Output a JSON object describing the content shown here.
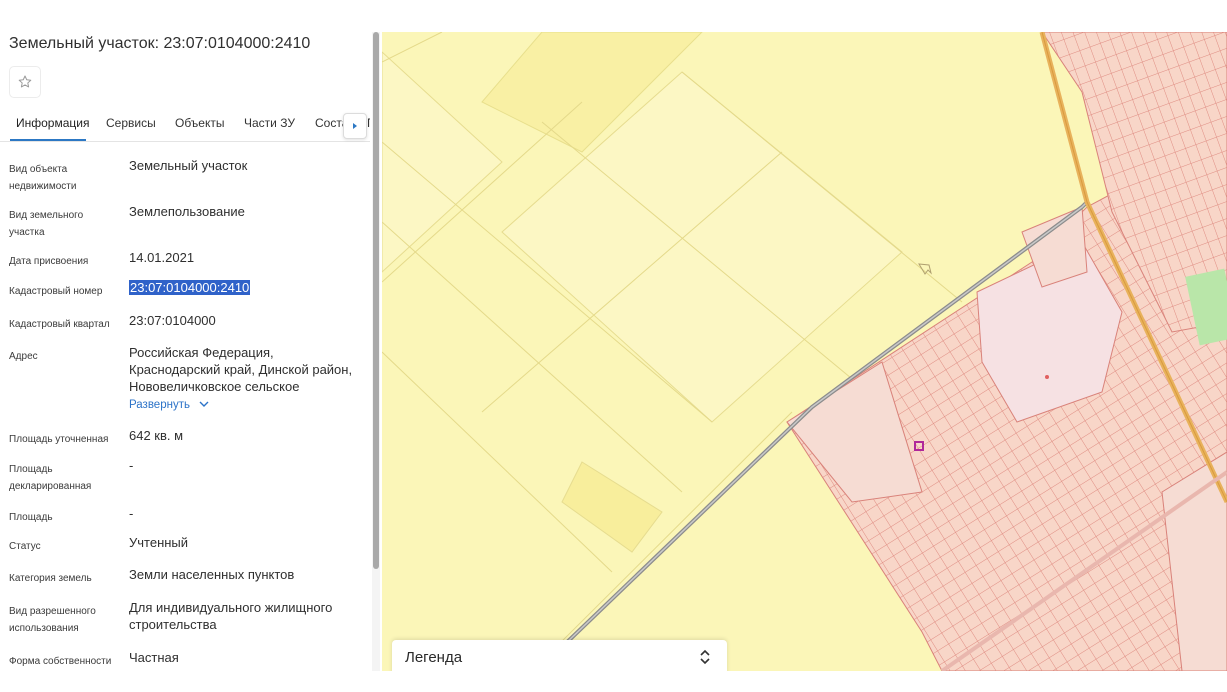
{
  "header": {
    "title": "Земельный участок: 23:07:0104000:2410"
  },
  "tabs": [
    {
      "label": "Информация",
      "active": true
    },
    {
      "label": "Сервисы"
    },
    {
      "label": "Объекты"
    },
    {
      "label": "Части ЗУ"
    },
    {
      "label": "Соста"
    },
    {
      "label": "П"
    }
  ],
  "fields": [
    {
      "label": "Вид объекта недвижимости",
      "value": "Земельный участок"
    },
    {
      "label": "Вид земельного участка",
      "value": "Землепользование"
    },
    {
      "label": "Дата присвоения",
      "value": "14.01.2021"
    },
    {
      "label": "Кадастровый номер",
      "value": "23:07:0104000:2410"
    },
    {
      "label": "Кадастровый квартал",
      "value": "23:07:0104000"
    },
    {
      "label": "Адрес",
      "value": "Российская Федерация, Краснодарский край, Динской район, Нововеличковское сельское",
      "link": "Развернуть"
    },
    {
      "label": "Площадь уточненная",
      "value": "642 кв. м"
    },
    {
      "label": "Площадь декларированная",
      "value": "-"
    },
    {
      "label": "Площадь",
      "value": "-"
    },
    {
      "label": "Статус",
      "value": "Учтенный"
    },
    {
      "label": "Категория земель",
      "value": "Земли населенных пунктов"
    },
    {
      "label": "Вид разрешенного использования",
      "value": "Для индивидуального жилищного строительства"
    },
    {
      "label": "Форма собственности",
      "value": "Частная"
    }
  ],
  "map": {
    "legend_label": "Легенда",
    "colors": {
      "field": "#fbf6b8",
      "parcel_fill": "#f7d8cc",
      "parcel_line": "#d9827a",
      "road": "#8c8c8c",
      "highway": "#e8b25c",
      "selected": "#b0279a",
      "green": "#b9e6a9"
    }
  }
}
